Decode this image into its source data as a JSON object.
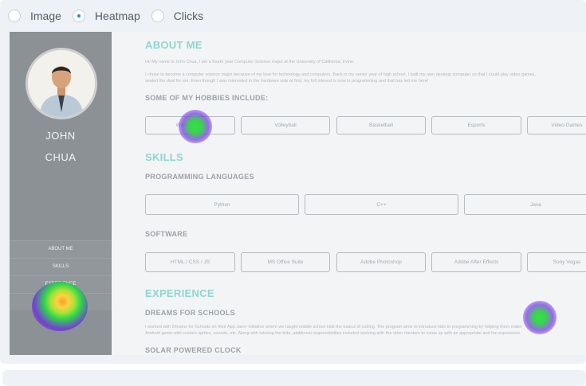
{
  "mode_selector": {
    "options": [
      {
        "label": "Image",
        "checked": false
      },
      {
        "label": "Heatmap",
        "checked": true
      },
      {
        "label": "Clicks",
        "checked": false
      }
    ]
  },
  "profile": {
    "first_name": "JOHN",
    "last_name": "CHUA",
    "nav": [
      "ABOUT ME",
      "SKILLS",
      "EXPERIENCE",
      "CONTACT"
    ]
  },
  "about": {
    "heading": "ABOUT ME",
    "intro": "Hi! My name is John Chua, I am a fourth year Computer Science major at the University of California, Irvine.",
    "para_line1": "I chose to become a computer science major because of my love for technology and computers. Back in my senior year of high school, I built my own desktop computer so that I could play video games,",
    "para_line2": "sealed the deal for me. Even though I was interested in the hardware side at first, my full interest is now in programming and that has led me here!",
    "hobbies_heading": "SOME OF MY HOBBIES INCLUDE:",
    "hobbies": [
      "Working Out",
      "Volleyball",
      "Basketball",
      "Esports",
      "Video Games"
    ]
  },
  "skills": {
    "heading": "SKILLS",
    "prog_heading": "PROGRAMMING LANGUAGES",
    "languages": [
      "Python",
      "C++",
      "Java"
    ],
    "software_heading": "SOFTWARE",
    "software": [
      "HTML / CSS / JS",
      "MS Office Suite",
      "Adobe Photoshop",
      "Adobe After Effects",
      "Sony Vegas"
    ]
  },
  "experience": {
    "heading": "EXPERIENCE",
    "job1_title": "DREAMS FOR SCHOOLS",
    "job1_line1": "I worked with Dreams for Schools on their App Jam+ initiative where we taught middle school kids the basics of coding. The program aims to introduce kids to programming by helping them make",
    "job1_line2": "Android game with custom sprites, sounds, etc. Along with tutoring the kids, additional responsibilities included working with the other mentors to come up with an appropriate and fun experience.",
    "job2_title": "SOLAR POWERED CLOCK"
  },
  "heatmap": {
    "spots": [
      {
        "target": "hobby-working-out",
        "intensity": 0.55
      },
      {
        "target": "nav-contact",
        "intensity": 1.0
      },
      {
        "target": "experience-text",
        "intensity": 0.5
      }
    ]
  }
}
